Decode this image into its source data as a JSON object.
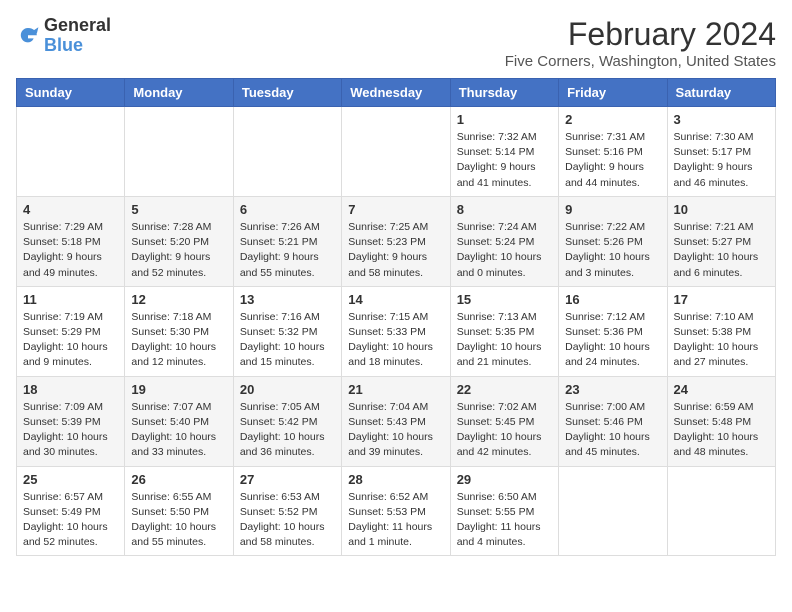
{
  "logo": {
    "line1": "General",
    "line2": "Blue"
  },
  "title": "February 2024",
  "subtitle": "Five Corners, Washington, United States",
  "days_of_week": [
    "Sunday",
    "Monday",
    "Tuesday",
    "Wednesday",
    "Thursday",
    "Friday",
    "Saturday"
  ],
  "weeks": [
    [
      {
        "day": "",
        "info": ""
      },
      {
        "day": "",
        "info": ""
      },
      {
        "day": "",
        "info": ""
      },
      {
        "day": "",
        "info": ""
      },
      {
        "day": "1",
        "info": "Sunrise: 7:32 AM\nSunset: 5:14 PM\nDaylight: 9 hours\nand 41 minutes."
      },
      {
        "day": "2",
        "info": "Sunrise: 7:31 AM\nSunset: 5:16 PM\nDaylight: 9 hours\nand 44 minutes."
      },
      {
        "day": "3",
        "info": "Sunrise: 7:30 AM\nSunset: 5:17 PM\nDaylight: 9 hours\nand 46 minutes."
      }
    ],
    [
      {
        "day": "4",
        "info": "Sunrise: 7:29 AM\nSunset: 5:18 PM\nDaylight: 9 hours\nand 49 minutes."
      },
      {
        "day": "5",
        "info": "Sunrise: 7:28 AM\nSunset: 5:20 PM\nDaylight: 9 hours\nand 52 minutes."
      },
      {
        "day": "6",
        "info": "Sunrise: 7:26 AM\nSunset: 5:21 PM\nDaylight: 9 hours\nand 55 minutes."
      },
      {
        "day": "7",
        "info": "Sunrise: 7:25 AM\nSunset: 5:23 PM\nDaylight: 9 hours\nand 58 minutes."
      },
      {
        "day": "8",
        "info": "Sunrise: 7:24 AM\nSunset: 5:24 PM\nDaylight: 10 hours\nand 0 minutes."
      },
      {
        "day": "9",
        "info": "Sunrise: 7:22 AM\nSunset: 5:26 PM\nDaylight: 10 hours\nand 3 minutes."
      },
      {
        "day": "10",
        "info": "Sunrise: 7:21 AM\nSunset: 5:27 PM\nDaylight: 10 hours\nand 6 minutes."
      }
    ],
    [
      {
        "day": "11",
        "info": "Sunrise: 7:19 AM\nSunset: 5:29 PM\nDaylight: 10 hours\nand 9 minutes."
      },
      {
        "day": "12",
        "info": "Sunrise: 7:18 AM\nSunset: 5:30 PM\nDaylight: 10 hours\nand 12 minutes."
      },
      {
        "day": "13",
        "info": "Sunrise: 7:16 AM\nSunset: 5:32 PM\nDaylight: 10 hours\nand 15 minutes."
      },
      {
        "day": "14",
        "info": "Sunrise: 7:15 AM\nSunset: 5:33 PM\nDaylight: 10 hours\nand 18 minutes."
      },
      {
        "day": "15",
        "info": "Sunrise: 7:13 AM\nSunset: 5:35 PM\nDaylight: 10 hours\nand 21 minutes."
      },
      {
        "day": "16",
        "info": "Sunrise: 7:12 AM\nSunset: 5:36 PM\nDaylight: 10 hours\nand 24 minutes."
      },
      {
        "day": "17",
        "info": "Sunrise: 7:10 AM\nSunset: 5:38 PM\nDaylight: 10 hours\nand 27 minutes."
      }
    ],
    [
      {
        "day": "18",
        "info": "Sunrise: 7:09 AM\nSunset: 5:39 PM\nDaylight: 10 hours\nand 30 minutes."
      },
      {
        "day": "19",
        "info": "Sunrise: 7:07 AM\nSunset: 5:40 PM\nDaylight: 10 hours\nand 33 minutes."
      },
      {
        "day": "20",
        "info": "Sunrise: 7:05 AM\nSunset: 5:42 PM\nDaylight: 10 hours\nand 36 minutes."
      },
      {
        "day": "21",
        "info": "Sunrise: 7:04 AM\nSunset: 5:43 PM\nDaylight: 10 hours\nand 39 minutes."
      },
      {
        "day": "22",
        "info": "Sunrise: 7:02 AM\nSunset: 5:45 PM\nDaylight: 10 hours\nand 42 minutes."
      },
      {
        "day": "23",
        "info": "Sunrise: 7:00 AM\nSunset: 5:46 PM\nDaylight: 10 hours\nand 45 minutes."
      },
      {
        "day": "24",
        "info": "Sunrise: 6:59 AM\nSunset: 5:48 PM\nDaylight: 10 hours\nand 48 minutes."
      }
    ],
    [
      {
        "day": "25",
        "info": "Sunrise: 6:57 AM\nSunset: 5:49 PM\nDaylight: 10 hours\nand 52 minutes."
      },
      {
        "day": "26",
        "info": "Sunrise: 6:55 AM\nSunset: 5:50 PM\nDaylight: 10 hours\nand 55 minutes."
      },
      {
        "day": "27",
        "info": "Sunrise: 6:53 AM\nSunset: 5:52 PM\nDaylight: 10 hours\nand 58 minutes."
      },
      {
        "day": "28",
        "info": "Sunrise: 6:52 AM\nSunset: 5:53 PM\nDaylight: 11 hours\nand 1 minute."
      },
      {
        "day": "29",
        "info": "Sunrise: 6:50 AM\nSunset: 5:55 PM\nDaylight: 11 hours\nand 4 minutes."
      },
      {
        "day": "",
        "info": ""
      },
      {
        "day": "",
        "info": ""
      }
    ]
  ]
}
